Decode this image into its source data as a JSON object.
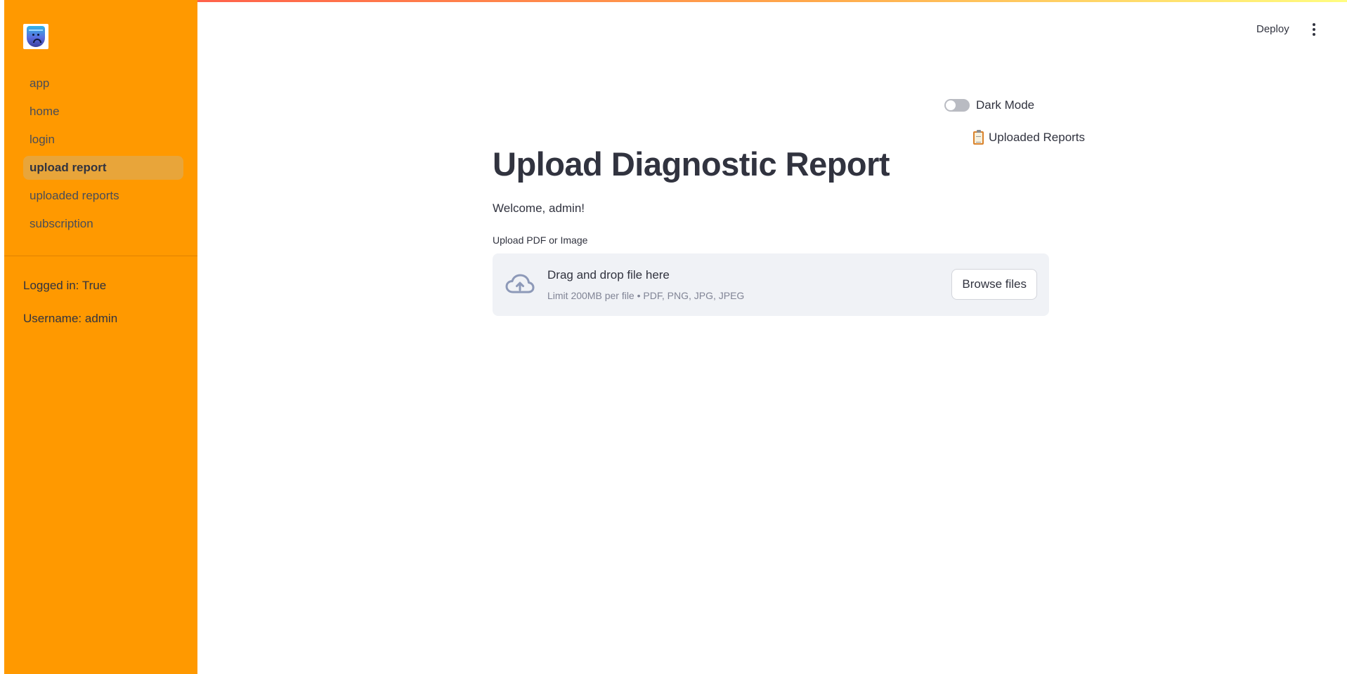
{
  "sidebar": {
    "logo_icon": "shield-mascot-icon",
    "items": [
      {
        "label": "app",
        "active": false
      },
      {
        "label": "home",
        "active": false
      },
      {
        "label": "login",
        "active": false
      },
      {
        "label": "upload report",
        "active": true
      },
      {
        "label": "uploaded reports",
        "active": false
      },
      {
        "label": "subscription",
        "active": false
      }
    ],
    "logged_in": "Logged in: True",
    "username": "Username: admin",
    "background_color": "#ff9900"
  },
  "header": {
    "deploy_label": "Deploy",
    "menu_icon": "kebab-menu-icon"
  },
  "controls": {
    "dark_mode_label": "Dark Mode",
    "dark_mode_on": false,
    "uploaded_reports_link": "Uploaded Reports",
    "uploaded_reports_icon": "clipboard-icon"
  },
  "main": {
    "title": "Upload Diagnostic Report",
    "welcome": "Welcome, admin!",
    "upload_label": "Upload PDF or Image",
    "dropzone": {
      "icon": "cloud-upload-icon",
      "title": "Drag and drop file here",
      "subtitle": "Limit 200MB per file • PDF, PNG, JPG, JPEG",
      "button_label": "Browse files"
    }
  }
}
